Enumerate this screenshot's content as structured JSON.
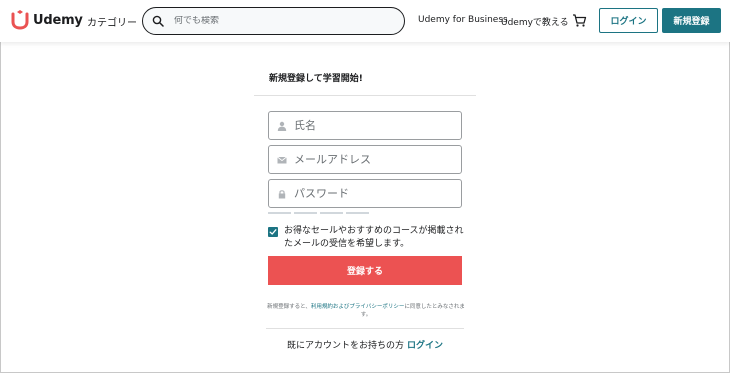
{
  "header": {
    "logo_text": "Udemy",
    "categories_label": "カテゴリー",
    "search_placeholder": "何でも検索",
    "business_link": "Udemy for Business",
    "teach_link": "Udemyで教える",
    "cart_icon": "cart-icon",
    "login_button": "ログイン",
    "signup_button": "新規登録"
  },
  "form": {
    "title": "新規登録して学習開始!",
    "fields": [
      {
        "icon": "person-icon",
        "placeholder": "氏名",
        "value": ""
      },
      {
        "icon": "envelope-icon",
        "placeholder": "メールアドレス",
        "value": ""
      },
      {
        "icon": "lock-icon",
        "placeholder": "パスワード",
        "value": ""
      }
    ],
    "consent_checked": true,
    "consent_text": "お得なセールやおすすめのコースが掲載されたメールの受信を希望します。",
    "submit_label": "登録する",
    "terms_prefix": "新規登録すると、",
    "terms_link": "利用規約およびプライバシーポリシー",
    "terms_suffix": "に同意したとみなされます。",
    "have_account_text": "既にアカウントをお持ちの方",
    "have_account_link": "ログイン"
  },
  "colors": {
    "accent": "#1c7483",
    "submit": "#ec5252",
    "brand": "#a435f0",
    "logo_red": "#ea5252"
  }
}
